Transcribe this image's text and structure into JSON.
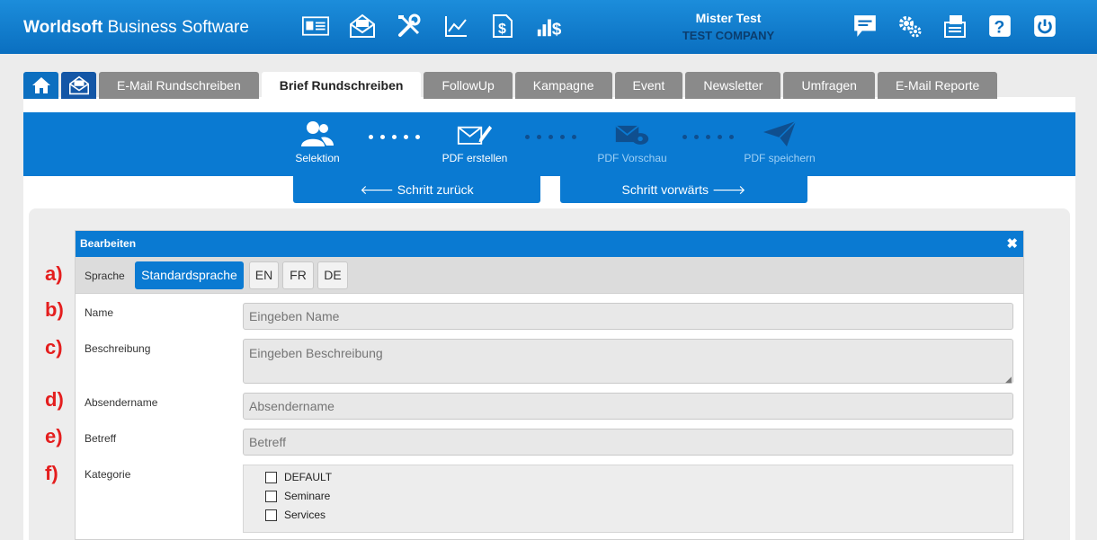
{
  "header": {
    "brand_bold": "Worldsoft",
    "brand_rest": " Business Software",
    "top_icons": [
      "contact-card-icon",
      "mail-open-icon",
      "tools-icon",
      "chart-line-icon",
      "invoice-dollar-icon",
      "revenue-chart-icon"
    ],
    "user_name": "Mister Test",
    "company": "TEST COMPANY",
    "right_icons": [
      "chat-icon",
      "settings-gears-icon",
      "fax-icon",
      "help-icon",
      "power-icon"
    ]
  },
  "tabs": [
    {
      "label": "E-Mail Rundschreiben",
      "active": false
    },
    {
      "label": "Brief Rundschreiben",
      "active": true
    },
    {
      "label": "FollowUp",
      "active": false
    },
    {
      "label": "Kampagne",
      "active": false
    },
    {
      "label": "Event",
      "active": false
    },
    {
      "label": "Newsletter",
      "active": false
    },
    {
      "label": "Umfragen",
      "active": false
    },
    {
      "label": "E-Mail Reporte",
      "active": false
    }
  ],
  "wizard": {
    "steps": [
      {
        "label": "Selektion",
        "icon": "users-icon"
      },
      {
        "label": "PDF erstellen",
        "icon": "mail-edit-icon"
      },
      {
        "label": "PDF Vorschau",
        "icon": "mail-preview-icon"
      },
      {
        "label": "PDF speichern",
        "icon": "paper-plane-icon"
      }
    ],
    "back_label": "🡐 Schritt zurück",
    "next_label": "Schritt vorwärts 🡒"
  },
  "dialog": {
    "title": "Bearbeiten",
    "close": "✖",
    "language_label": "Sprache",
    "languages": [
      "Standardsprache",
      "EN",
      "FR",
      "DE"
    ],
    "fields": {
      "name_label": "Name",
      "name_placeholder": "Eingeben Name",
      "description_label": "Beschreibung",
      "description_placeholder": "Eingeben Beschreibung",
      "sender_label": "Absendername",
      "sender_placeholder": "Absendername",
      "subject_label": "Betreff",
      "subject_placeholder": "Betreff",
      "category_label": "Kategorie"
    },
    "categories": [
      "DEFAULT",
      "Seminare",
      "Services"
    ]
  },
  "annotations": [
    "a)",
    "b)",
    "c)",
    "d)",
    "e)",
    "f)"
  ]
}
